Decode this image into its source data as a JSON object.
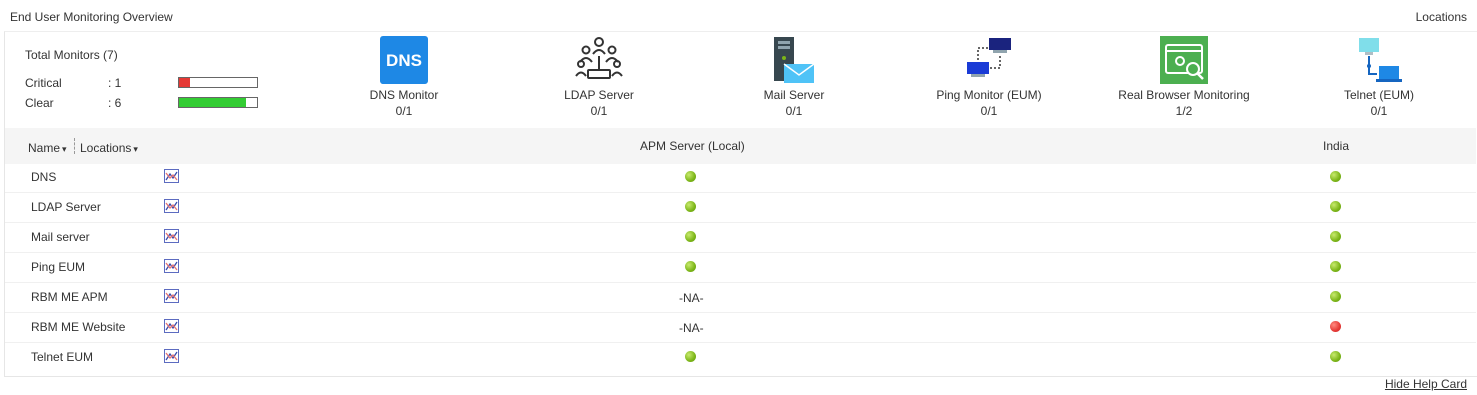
{
  "header": {
    "title": "End User Monitoring Overview",
    "locations_link": "Locations"
  },
  "summary": {
    "total_label": "Total Monitors (7)",
    "rows": [
      {
        "label": "Critical",
        "value": ": 1",
        "fraction": 0.143,
        "color": "#e53935"
      },
      {
        "label": "Clear",
        "value": ": 6",
        "fraction": 0.857,
        "color": "#33cc33"
      }
    ]
  },
  "monitor_types": [
    {
      "name": "DNS Monitor",
      "count": "0/1",
      "icon": "dns-icon",
      "icon_text": "DNS"
    },
    {
      "name": "LDAP Server",
      "count": "0/1",
      "icon": "ldap-icon"
    },
    {
      "name": "Mail Server",
      "count": "0/1",
      "icon": "mail-server-icon"
    },
    {
      "name": "Ping Monitor (EUM)",
      "count": "0/1",
      "icon": "ping-icon"
    },
    {
      "name": "Real Browser Monitoring",
      "count": "1/2",
      "icon": "rbm-icon"
    },
    {
      "name": "Telnet (EUM)",
      "count": "0/1",
      "icon": "telnet-icon"
    }
  ],
  "table": {
    "col_name": "Name",
    "col_locations": "Locations",
    "sort_glyph": "▾",
    "col_apm": "APM Server (Local)",
    "col_india": "India",
    "rows": [
      {
        "name": "DNS",
        "apm": "green",
        "india": "green"
      },
      {
        "name": "LDAP Server",
        "apm": "green",
        "india": "green"
      },
      {
        "name": "Mail server",
        "apm": "green",
        "india": "green"
      },
      {
        "name": "Ping EUM",
        "apm": "green",
        "india": "green"
      },
      {
        "name": "RBM ME APM",
        "apm": "-NA-",
        "india": "green"
      },
      {
        "name": "RBM ME Website",
        "apm": "-NA-",
        "india": "red"
      },
      {
        "name": "Telnet EUM",
        "apm": "green",
        "india": "green"
      }
    ]
  },
  "footer": {
    "help_link": "Hide Help Card"
  },
  "colors": {
    "green_status": "#7cb518",
    "red_status": "#e53935",
    "accent_blue": "#1e88e5"
  }
}
